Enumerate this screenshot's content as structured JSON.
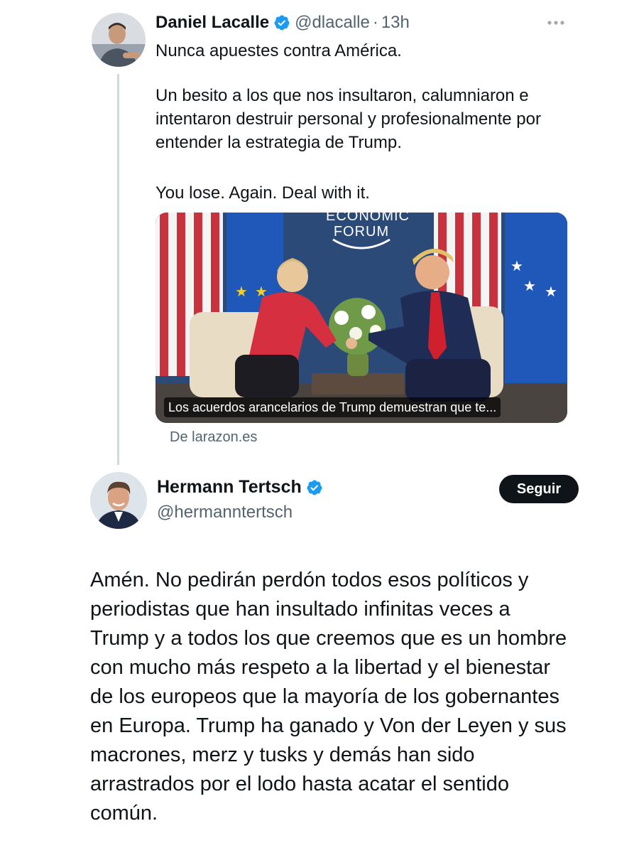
{
  "tweet": {
    "author": {
      "name": "Daniel Lacalle",
      "handle": "@dlacalle",
      "separator": "·",
      "time": "13h",
      "avatar_icon": "avatar-photo-icon"
    },
    "text_line_1": "Nunca apuestes contra América.",
    "text_para_2": "Un besito a los que nos insultaron, calumniaron e intentaron destruir personal y profesionalmente por entender la estrategia de Trump.",
    "text_para_3": "You lose. Again. Deal with it.",
    "card": {
      "caption": "Los acuerdos arancelarios de Trump demuestran que te...",
      "source": "De larazon.es",
      "image_text_line_1": "ECONOMIC",
      "image_text_line_2": "FORUM"
    }
  },
  "quote": {
    "author": {
      "name": "Hermann Tertsch",
      "handle": "@hermanntertsch",
      "avatar_icon": "avatar-photo-icon"
    },
    "follow_label": "Seguir",
    "text": "Amén. No pedirán perdón todos esos políticos y periodistas que han insultado infinitas veces a Trump y a todos los que creemos que es un hombre con mucho más respeto a la libertad y el bienestar de los europeos que la mayoría de los gobernantes en Europa. Trump ha ganado y Von der Leyen y sus macrones, merz y tusks y demás han sido arrastrados por el lodo hasta acatar el sentido común."
  },
  "colors": {
    "text_primary": "#0f1419",
    "text_secondary": "#536471",
    "verified_blue": "#1d9bf0",
    "thread_line": "#cfd9de"
  }
}
